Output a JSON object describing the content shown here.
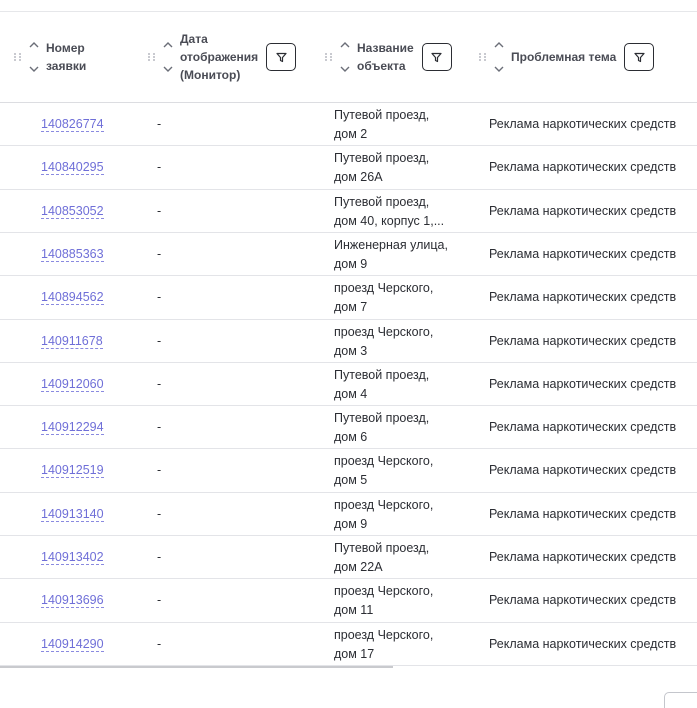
{
  "table": {
    "columns": [
      {
        "key": "id",
        "title_lines": [
          "Номер",
          "заявки"
        ]
      },
      {
        "key": "date",
        "title_lines": [
          "Дата",
          "отображения",
          "(Монитор)"
        ]
      },
      {
        "key": "object",
        "title_lines": [
          "Название",
          "объекта"
        ]
      },
      {
        "key": "theme",
        "title_lines": [
          "Проблемная тема"
        ]
      }
    ],
    "rows": [
      {
        "id": "140826774",
        "date": "-",
        "object": [
          "Путевой проезд,",
          "дом 2"
        ],
        "theme": "Реклама наркотических средств"
      },
      {
        "id": "140840295",
        "date": "-",
        "object": [
          "Путевой проезд,",
          "дом 26А"
        ],
        "theme": "Реклама наркотических средств"
      },
      {
        "id": "140853052",
        "date": "-",
        "object": [
          "Путевой проезд,",
          "дом 40, корпус 1,..."
        ],
        "theme": "Реклама наркотических средств"
      },
      {
        "id": "140885363",
        "date": "-",
        "object": [
          "Инженерная улица,",
          "дом 9"
        ],
        "theme": "Реклама наркотических средств"
      },
      {
        "id": "140894562",
        "date": "-",
        "object": [
          "проезд Черского,",
          "дом 7"
        ],
        "theme": "Реклама наркотических средств"
      },
      {
        "id": "140911678",
        "date": "-",
        "object": [
          "проезд Черского,",
          "дом 3"
        ],
        "theme": "Реклама наркотических средств"
      },
      {
        "id": "140912060",
        "date": "-",
        "object": [
          "Путевой проезд,",
          "дом 4"
        ],
        "theme": "Реклама наркотических средств"
      },
      {
        "id": "140912294",
        "date": "-",
        "object": [
          "Путевой проезд,",
          "дом 6"
        ],
        "theme": "Реклама наркотических средств"
      },
      {
        "id": "140912519",
        "date": "-",
        "object": [
          "проезд Черского,",
          "дом 5"
        ],
        "theme": "Реклама наркотических средств"
      },
      {
        "id": "140913140",
        "date": "-",
        "object": [
          "проезд Черского,",
          "дом 9"
        ],
        "theme": "Реклама наркотических средств"
      },
      {
        "id": "140913402",
        "date": "-",
        "object": [
          "Путевой проезд,",
          "дом 22А"
        ],
        "theme": "Реклама наркотических средств"
      },
      {
        "id": "140913696",
        "date": "-",
        "object": [
          "проезд Черского,",
          "дом 11"
        ],
        "theme": "Реклама наркотических средств"
      },
      {
        "id": "140914290",
        "date": "-",
        "object": [
          "проезд Черского,",
          "дом 17"
        ],
        "theme": "Реклама наркотических средств"
      }
    ]
  },
  "icons": {
    "drag": "drag-handle-icon",
    "sort_up": "chevron-up-icon",
    "sort_down": "chevron-down-icon",
    "filter": "filter-icon"
  },
  "colors": {
    "link": "#6f6fd8",
    "text": "#2b2d33",
    "header_text": "#4a4c55"
  }
}
